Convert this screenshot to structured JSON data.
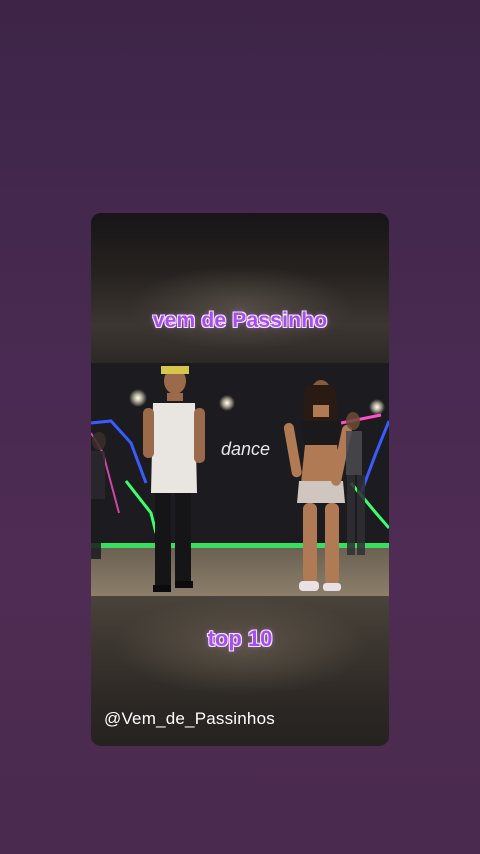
{
  "story": {
    "title": "vem de Passinho",
    "caption": "top 10",
    "handle": "@Vem_de_Passinhos"
  },
  "video": {
    "watermark": "dance"
  },
  "colors": {
    "background_top": "#3d2548",
    "background_bottom": "#4a2a4e",
    "text_fill": "#a84df0",
    "text_outline": "#f4e6ff",
    "neon_blue": "#3a5cff",
    "neon_green": "#3cff6a",
    "neon_pink": "#ff4fc8"
  }
}
